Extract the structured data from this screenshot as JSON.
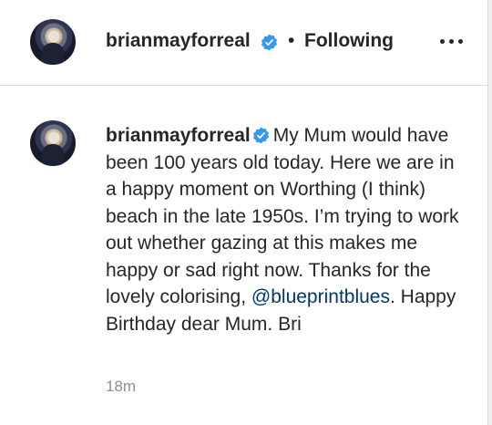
{
  "header": {
    "username": "brianmayforreal",
    "separator": "•",
    "follow_status": "Following",
    "verified_icon": "verified-badge-icon",
    "more_icon": "more-options-icon"
  },
  "comment": {
    "username": "brianmayforreal",
    "text_before_mention": "My Mum would have been 100 years old today. Here we are in a happy moment on Worthing (I think) beach in the late 1950s. I’m trying to work out whether gazing at this makes me happy or sad right now. Thanks for the lovely colorising, ",
    "mention": "@blueprintblues",
    "text_after_mention": ". Happy Birthday dear Mum. Bri",
    "timestamp": "18m"
  },
  "colors": {
    "verified_blue": "#3897f0",
    "mention_blue": "#00376b",
    "timestamp_gray": "#8e8e8e",
    "divider": "#dbdbdb"
  }
}
